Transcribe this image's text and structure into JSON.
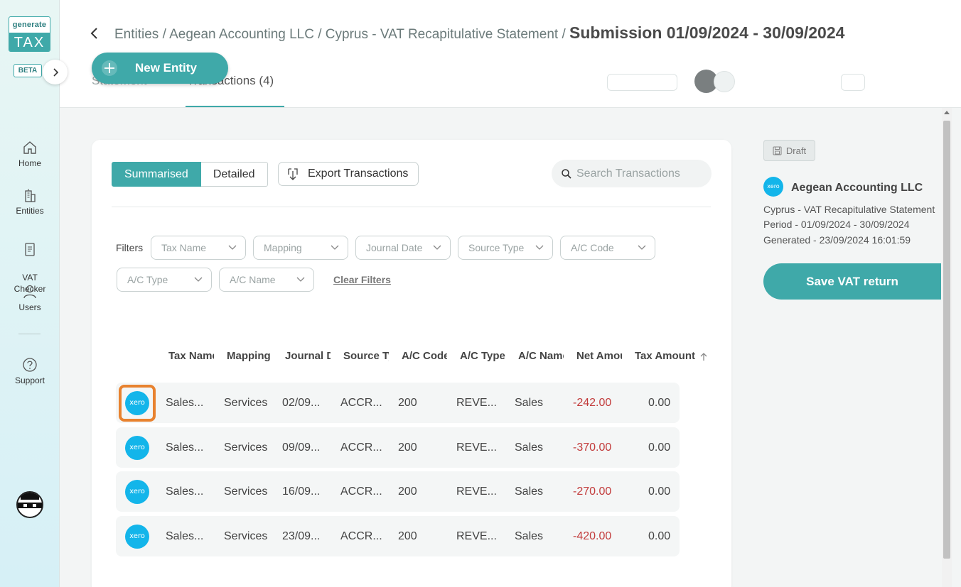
{
  "sidebar": {
    "logo_top": "generate",
    "logo_bottom": "TAX",
    "beta": "BETA",
    "items": [
      {
        "label": "Home"
      },
      {
        "label": "Entities"
      },
      {
        "label": "VAT\nChecker"
      },
      {
        "label": "Users"
      },
      {
        "label": "Support"
      }
    ]
  },
  "header": {
    "breadcrumb": "Entities / Aegean Accounting LLC / Cyprus - VAT Recapitulative Statement / ",
    "current": "Submission 01/09/2024 - 30/09/2024",
    "new_entity": "New Entity",
    "tabs": [
      "Statement",
      "Transactions (4)"
    ]
  },
  "toolbar": {
    "summarised": "Summarised",
    "detailed": "Detailed",
    "export": "Export Transactions",
    "search_placeholder": "Search Transactions"
  },
  "filters": {
    "label": "Filters",
    "items": [
      "Tax Name",
      "Mapping",
      "Journal Date",
      "Source Type",
      "A/C Code",
      "A/C Type",
      "A/C Name"
    ],
    "clear": "Clear Filters"
  },
  "table": {
    "columns": [
      "Tax Name",
      "Mapping",
      "Journal Date",
      "Source Type",
      "A/C Code",
      "A/C Type",
      "A/C Name",
      "Net Amount",
      "Tax Amount"
    ],
    "logo_text": "xero",
    "rows": [
      {
        "tax_name": "Sales...",
        "mapping": "Services",
        "journal_date": "02/09...",
        "source_type": "ACCR...",
        "ac_code": "200",
        "ac_type": "REVE...",
        "ac_name": "Sales",
        "net": "-242.00",
        "tax": "0.00"
      },
      {
        "tax_name": "Sales...",
        "mapping": "Services",
        "journal_date": "09/09...",
        "source_type": "ACCR...",
        "ac_code": "200",
        "ac_type": "REVE...",
        "ac_name": "Sales",
        "net": "-370.00",
        "tax": "0.00"
      },
      {
        "tax_name": "Sales...",
        "mapping": "Services",
        "journal_date": "16/09...",
        "source_type": "ACCR...",
        "ac_code": "200",
        "ac_type": "REVE...",
        "ac_name": "Sales",
        "net": "-270.00",
        "tax": "0.00"
      },
      {
        "tax_name": "Sales...",
        "mapping": "Services",
        "journal_date": "23/09...",
        "source_type": "ACCR...",
        "ac_code": "200",
        "ac_type": "REVE...",
        "ac_name": "Sales",
        "net": "-420.00",
        "tax": "0.00"
      }
    ]
  },
  "panel": {
    "status": "Draft",
    "logo_text": "xero",
    "entity": "Aegean Accounting LLC",
    "return_type": "Cyprus - VAT Recapitulative Statement",
    "period": "Period - 01/09/2024 - 30/09/2024",
    "generated": "Generated - 23/09/2024 16:01:59",
    "save": "Save VAT return"
  },
  "colors": {
    "accent": "#3fa9a9",
    "negative": "#c23b3b",
    "xero": "#13b5ea",
    "highlight": "#e8822f"
  }
}
